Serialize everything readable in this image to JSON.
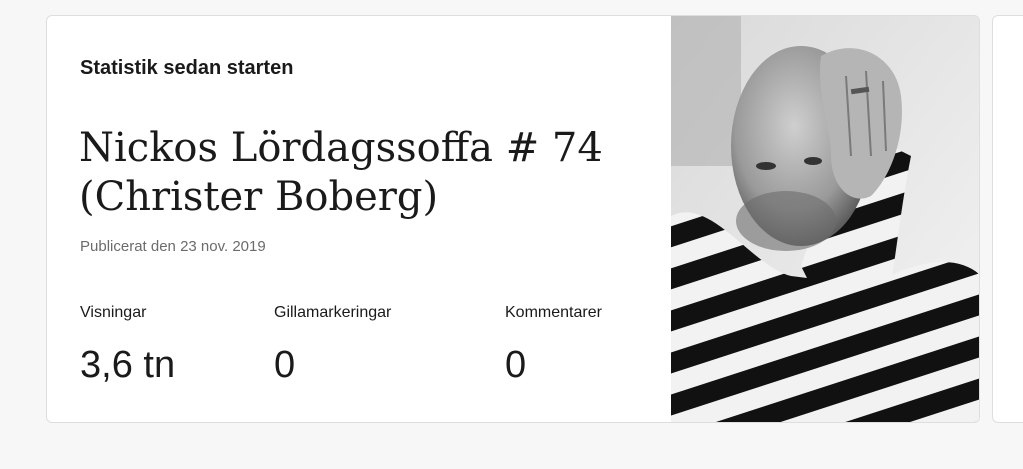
{
  "card": {
    "section_title": "Statistik sedan starten",
    "post_title_line1": "Nickos Lördagssoffa # 74",
    "post_title_line2": "(Christer Boberg)",
    "published": "Publicerat den 23 nov. 2019",
    "stats": [
      {
        "label": "Visningar",
        "value": "3,6 tn"
      },
      {
        "label": "Gillamarkeringar",
        "value": "0"
      },
      {
        "label": "Kommentarer",
        "value": "0"
      }
    ],
    "photo_description_icon": "post-photo"
  },
  "colors": {
    "background": "#f7f7f7",
    "card": "#ffffff",
    "border": "#dedede",
    "text": "#1a1a1a",
    "muted": "#6b6b6b"
  }
}
